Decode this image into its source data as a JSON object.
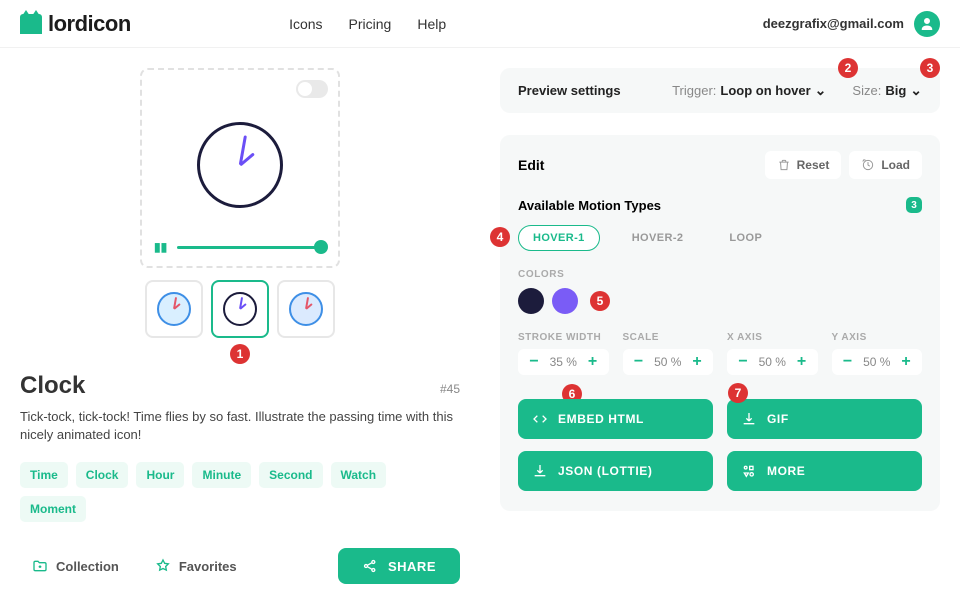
{
  "header": {
    "brand": "lordicon",
    "nav": [
      "Icons",
      "Pricing",
      "Help"
    ],
    "user_email": "deezgrafix@gmail.com"
  },
  "icon": {
    "title": "Clock",
    "id": "#45",
    "description": "Tick-tock, tick-tock! Time flies by so fast. Illustrate the passing time with this nicely animated icon!",
    "tags": [
      "Time",
      "Clock",
      "Hour",
      "Minute",
      "Second",
      "Watch",
      "Moment"
    ]
  },
  "actions": {
    "collection": "Collection",
    "favorites": "Favorites",
    "share": "SHARE"
  },
  "preview": {
    "title": "Preview settings",
    "trigger_label": "Trigger:",
    "trigger_value": "Loop on hover",
    "size_label": "Size:",
    "size_value": "Big"
  },
  "edit": {
    "title": "Edit",
    "reset": "Reset",
    "load": "Load",
    "motion_title": "Available Motion Types",
    "motion_count": "3",
    "motions": [
      "HOVER-1",
      "HOVER-2",
      "LOOP"
    ],
    "colors_label": "COLORS",
    "colors": [
      "#1c1c3c",
      "#7a5cf6"
    ],
    "controls": [
      {
        "label": "STROKE WIDTH",
        "value": "35 %"
      },
      {
        "label": "SCALE",
        "value": "50 %"
      },
      {
        "label": "X AXIS",
        "value": "50 %"
      },
      {
        "label": "Y AXIS",
        "value": "50 %"
      }
    ]
  },
  "download": {
    "embed": "EMBED HTML",
    "gif": "GIF",
    "json": "JSON (LOTTIE)",
    "more": "MORE"
  },
  "annotations": {
    "1": "1",
    "2": "2",
    "3": "3",
    "4": "4",
    "5": "5",
    "6": "6",
    "7": "7"
  }
}
